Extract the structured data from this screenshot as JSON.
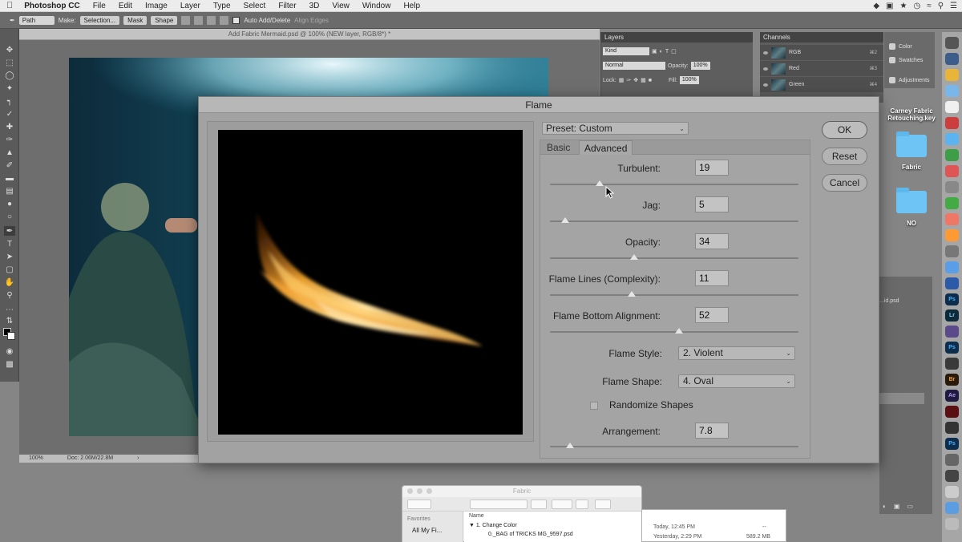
{
  "menubar": {
    "apple_icon": "apple-icon",
    "app_name": "Photoshop CC",
    "items": [
      "File",
      "Edit",
      "Image",
      "Layer",
      "Type",
      "Select",
      "Filter",
      "3D",
      "View",
      "Window",
      "Help"
    ]
  },
  "options_bar": {
    "mode_select": "Path",
    "make_label": "Make:",
    "selection_btn": "Selection...",
    "mask_btn": "Mask",
    "shape_btn": "Shape",
    "auto_add_delete": "Auto Add/Delete",
    "align_edges": "Align Edges"
  },
  "document": {
    "title": "Add Fabric Mermaid.psd @ 100% (NEW layer, RGB/8*) *",
    "zoom": "100%",
    "doc_size": "Doc: 2.06M/22.8M"
  },
  "layers_panel": {
    "title": "Layers",
    "kind": "Kind",
    "blend_mode": "Normal",
    "opacity_label": "Opacity:",
    "opacity_value": "100%",
    "lock_label": "Lock:",
    "fill_label": "Fill:",
    "fill_value": "100%"
  },
  "channels_panel": {
    "title": "Channels",
    "channels": [
      {
        "name": "RGB",
        "key": "⌘2"
      },
      {
        "name": "Red",
        "key": "⌘3"
      },
      {
        "name": "Green",
        "key": "⌘4"
      }
    ]
  },
  "side_panels": {
    "color": "Color",
    "swatches": "Swatches",
    "adjustments": "Adjustments"
  },
  "desktop": {
    "file1": "Carney Fabric Retouching.key",
    "folder1": "Fabric",
    "folder2": "NO"
  },
  "history_panel": {
    "item": "...id.psd"
  },
  "flame_dialog": {
    "title": "Flame",
    "preset": "Preset: Custom",
    "tabs": [
      "Basic",
      "Advanced"
    ],
    "active_tab": "Advanced",
    "params": [
      {
        "label": "Turbulent:",
        "value": "19",
        "level": 0.2
      },
      {
        "label": "Jag:",
        "value": "5",
        "level": 0.06
      },
      {
        "label": "Opacity:",
        "value": "34",
        "level": 0.34
      },
      {
        "label": "Flame Lines (Complexity):",
        "value": "11",
        "level": 0.33
      },
      {
        "label": "Flame Bottom Alignment:",
        "value": "52",
        "level": 0.52
      }
    ],
    "flame_style_label": "Flame Style:",
    "flame_style_value": "2. Violent",
    "flame_shape_label": "Flame Shape:",
    "flame_shape_value": "4. Oval",
    "randomize_label": "Randomize Shapes",
    "randomize_checked": false,
    "arrangement_label": "Arrangement:",
    "arrangement_value": "7.8",
    "arrangement_level": 0.08,
    "ok": "OK",
    "reset": "Reset",
    "cancel": "Cancel"
  },
  "finder": {
    "title": "Fabric",
    "favorites": "Favorites",
    "all_my_files": "All My Fi...",
    "col_name": "Name",
    "rows": [
      {
        "name": "1. Change Color",
        "date": "Today, 12:45 PM",
        "size": "--"
      },
      {
        "name": "0._BAG of TRICKS MG_9597.psd",
        "date": "Yesterday, 2:29 PM",
        "size": "589.2 MB"
      }
    ]
  },
  "dock": {
    "apps": [
      "Ps",
      "Lr",
      "Ps",
      "Br",
      "Ae",
      "Ps"
    ]
  }
}
